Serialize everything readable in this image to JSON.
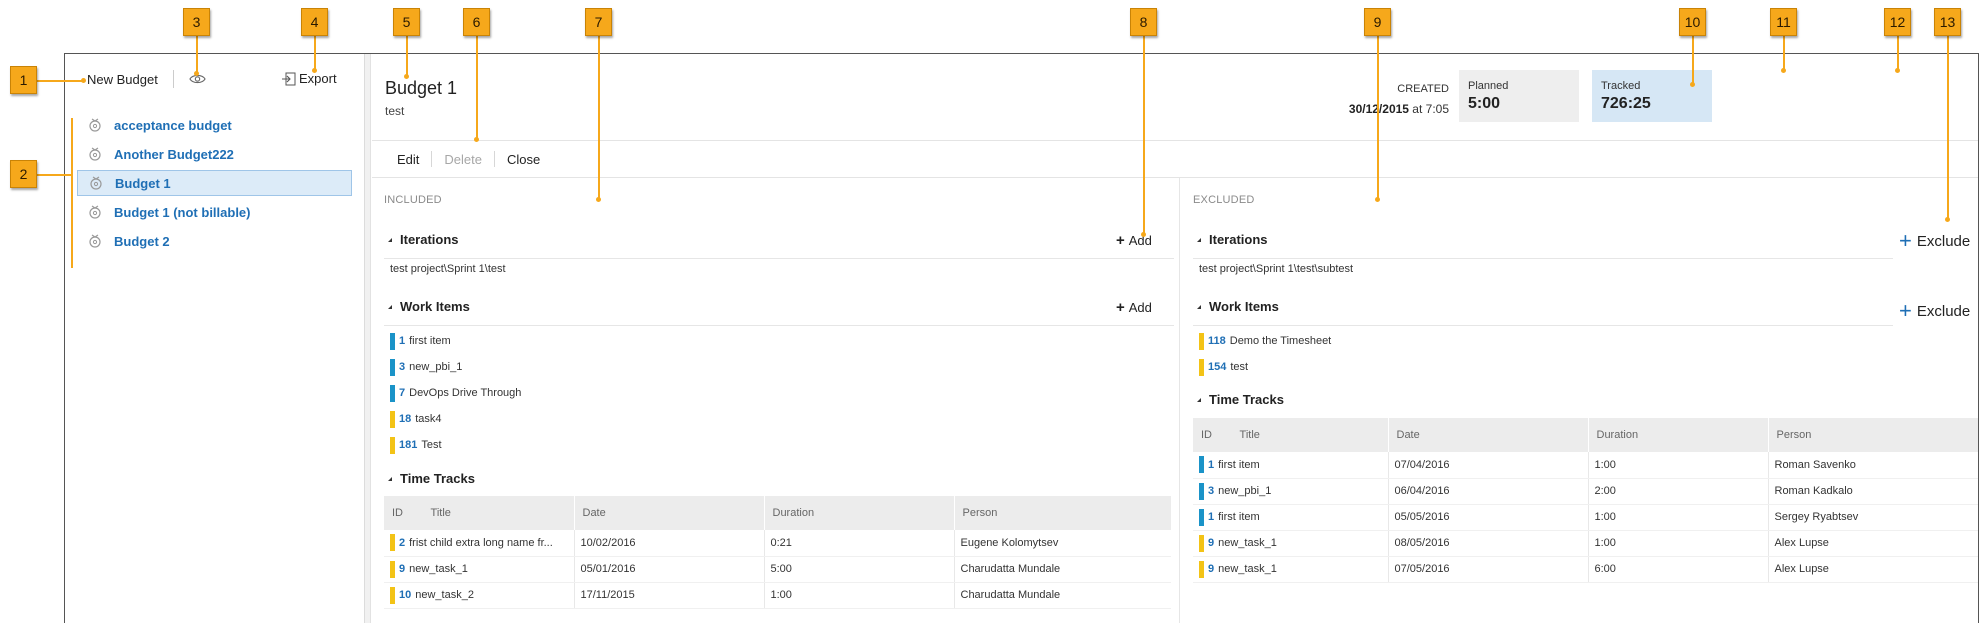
{
  "callouts": [
    "1",
    "2",
    "3",
    "4",
    "5",
    "6",
    "7",
    "8",
    "9",
    "10",
    "11",
    "12",
    "13"
  ],
  "colors": {
    "callout": "#f6a81b",
    "link": "#1f6fb5",
    "bar_blue": "#1a93c8",
    "bar_yellow": "#f3c316"
  },
  "sidebar": {
    "new_budget_label": "New Budget",
    "view_icon": "eye-icon",
    "export_label": "Export",
    "export_icon": "export-icon",
    "items": [
      {
        "label": "acceptance budget",
        "selected": false
      },
      {
        "label": "Another Budget222",
        "selected": false
      },
      {
        "label": "Budget 1",
        "selected": true
      },
      {
        "label": "Budget 1 (not billable)",
        "selected": false
      },
      {
        "label": "Budget 2",
        "selected": false
      }
    ]
  },
  "header": {
    "title": "Budget 1",
    "subtitle": "test",
    "created_label": "CREATED",
    "created_date": "30/12/2015",
    "created_time": " at 7:05",
    "planned_label": "Planned",
    "planned_value": "5:00",
    "tracked_label": "Tracked",
    "tracked_value": "726:25"
  },
  "commands": {
    "edit": "Edit",
    "delete": "Delete",
    "close": "Close"
  },
  "included": {
    "heading": "INCLUDED",
    "iterations_title": "Iterations",
    "add_label": "Add",
    "iterations": [
      "test project\\Sprint 1\\test"
    ],
    "work_items_title": "Work Items",
    "work_items": [
      {
        "id": "1",
        "title": "first item",
        "color": "#1a93c8"
      },
      {
        "id": "3",
        "title": "new_pbi_1",
        "color": "#1a93c8"
      },
      {
        "id": "7",
        "title": "DevOps Drive Through",
        "color": "#1a93c8"
      },
      {
        "id": "18",
        "title": "task4",
        "color": "#f3c316"
      },
      {
        "id": "181",
        "title": "Test",
        "color": "#f3c316"
      }
    ],
    "time_tracks_title": "Time Tracks",
    "columns": [
      "ID",
      "Title",
      "Date",
      "Duration",
      "Person"
    ],
    "time_tracks": [
      {
        "id": "2",
        "title": "frist child extra long name fr...",
        "date": "10/02/2016",
        "duration": "0:21",
        "person": "Eugene Kolomytsev",
        "color": "#f3c316"
      },
      {
        "id": "9",
        "title": "new_task_1",
        "date": "05/01/2016",
        "duration": "5:00",
        "person": "Charudatta Mundale",
        "color": "#f3c316"
      },
      {
        "id": "10",
        "title": "new_task_2",
        "date": "17/11/2015",
        "duration": "1:00",
        "person": "Charudatta Mundale",
        "color": "#f3c316"
      }
    ]
  },
  "excluded": {
    "heading": "EXCLUDED",
    "iterations_title": "Iterations",
    "exclude_label": "Exclude",
    "iterations": [
      "test project\\Sprint 1\\test\\subtest"
    ],
    "work_items_title": "Work Items",
    "work_items": [
      {
        "id": "118",
        "title": "Demo the Timesheet",
        "color": "#f3c316"
      },
      {
        "id": "154",
        "title": "test",
        "color": "#f3c316"
      }
    ],
    "time_tracks_title": "Time Tracks",
    "columns": [
      "ID",
      "Title",
      "Date",
      "Duration",
      "Person"
    ],
    "time_tracks": [
      {
        "id": "1",
        "title": "first item",
        "date": "07/04/2016",
        "duration": "1:00",
        "person": "Roman Savenko",
        "color": "#1a93c8"
      },
      {
        "id": "3",
        "title": "new_pbi_1",
        "date": "06/04/2016",
        "duration": "2:00",
        "person": "Roman Kadkalo",
        "color": "#1a93c8"
      },
      {
        "id": "1",
        "title": "first item",
        "date": "05/05/2016",
        "duration": "1:00",
        "person": "Sergey Ryabtsev",
        "color": "#1a93c8"
      },
      {
        "id": "9",
        "title": "new_task_1",
        "date": "08/05/2016",
        "duration": "1:00",
        "person": "Alex Lupse",
        "color": "#f3c316"
      },
      {
        "id": "9",
        "title": "new_task_1",
        "date": "07/05/2016",
        "duration": "6:00",
        "person": "Alex Lupse",
        "color": "#f3c316"
      }
    ]
  }
}
